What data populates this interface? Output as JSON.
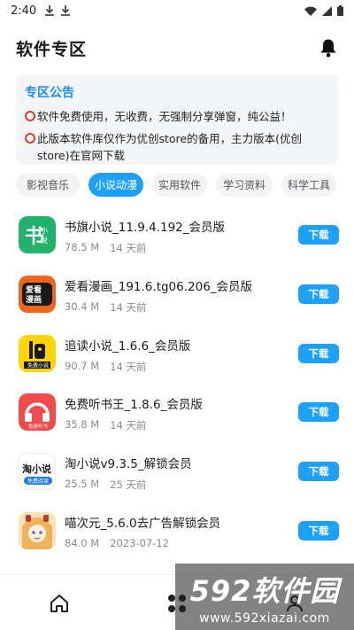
{
  "status_bar": {
    "time": "2:40",
    "left_icons": [
      "download-icon",
      "download-icon"
    ],
    "right_icons": [
      "wifi-icon",
      "signal-icon",
      "battery-icon"
    ]
  },
  "header": {
    "title": "软件专区",
    "bell_icon": "bell-icon"
  },
  "notice": {
    "title": "专区公告",
    "lines": [
      "软件免费使用，无收费，无强制分享弹窗，纯公益！",
      "此版本软件库仅作为优创store的备用，主力版本(优创store)在官网下载"
    ]
  },
  "tabs": [
    {
      "label": "影视音乐",
      "active": false
    },
    {
      "label": "小说动漫",
      "active": true
    },
    {
      "label": "实用软件",
      "active": false
    },
    {
      "label": "学习资料",
      "active": false
    },
    {
      "label": "科学工具",
      "active": false
    }
  ],
  "apps": [
    {
      "name": "书旗小说_11.9.4.192_会员版",
      "size": "78.5 M",
      "time": "14 天前",
      "button": "下载",
      "icon_text": "小说",
      "icon_color": "#21b36b"
    },
    {
      "name": "爱看漫画_191.6.tg06.206_会员版",
      "size": "30.4 M",
      "time": "14 天前",
      "button": "下载",
      "icon_text": "爱看漫画",
      "icon_color": "#f0641e"
    },
    {
      "name": "追读小说_1.6.6_会员版",
      "size": "90.7 M",
      "time": "14 天前",
      "button": "下载",
      "icon_text": "免费小说",
      "icon_color": "#ffd400"
    },
    {
      "name": "免费听书王_1.8.6_会员版",
      "size": "35.8 M",
      "time": "14 天前",
      "button": "下载",
      "icon_text": "免费听书",
      "icon_color": "#f04a4a"
    },
    {
      "name": "淘小说v9.3.5_解锁会员",
      "size": "25.5 M",
      "time": "25 天前",
      "button": "下载",
      "icon_text": "淘小说",
      "icon_color": "#ffffff"
    },
    {
      "name": "喵次元_5.6.0去广告解锁会员",
      "size": "84.0 M",
      "time": "2023-07-12",
      "button": "下载",
      "icon_text": "",
      "icon_color": "#f7c08a"
    }
  ],
  "bottom_nav": [
    "home-icon",
    "grid-icon",
    "user-icon"
  ],
  "watermark": {
    "main": "592软件园",
    "url": "www.592xiazai.com"
  }
}
